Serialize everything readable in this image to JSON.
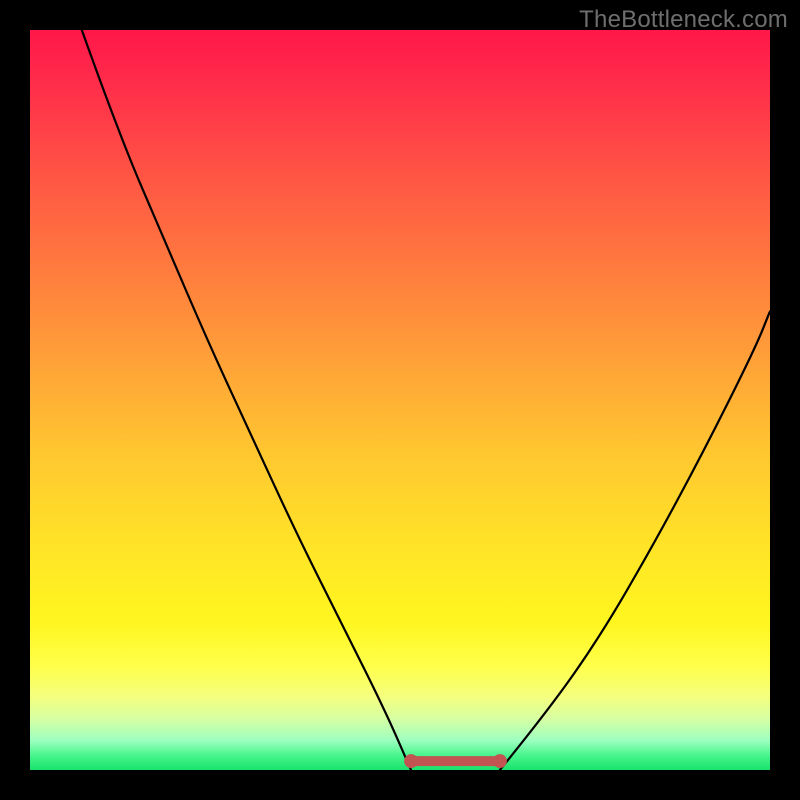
{
  "watermark": "TheBottleneck.com",
  "colors": {
    "flat_stroke": "#c25451",
    "dot_fill": "#c25451"
  },
  "chart_data": {
    "type": "line",
    "title": "",
    "xlabel": "",
    "ylabel": "",
    "xlim": [
      0,
      100
    ],
    "ylim": [
      0,
      100
    ],
    "grid": false,
    "series": [
      {
        "name": "left-curve",
        "x": [
          7,
          12,
          18,
          24,
          30,
          36,
          42,
          48,
          51.5
        ],
        "values": [
          100,
          86,
          72,
          58,
          45,
          32,
          20,
          8,
          0
        ]
      },
      {
        "name": "right-curve",
        "x": [
          63.5,
          70,
          77,
          84,
          91,
          98,
          100
        ],
        "values": [
          0,
          8,
          18,
          30,
          43,
          57,
          62
        ]
      },
      {
        "name": "flat-bottom",
        "x": [
          51.5,
          63.5
        ],
        "values": [
          1.2,
          1.2
        ]
      }
    ],
    "annotations": [
      {
        "name": "flat-start-dot",
        "x": 51.5,
        "y": 1.2
      },
      {
        "name": "flat-end-dot",
        "x": 63.5,
        "y": 1.2
      }
    ]
  }
}
